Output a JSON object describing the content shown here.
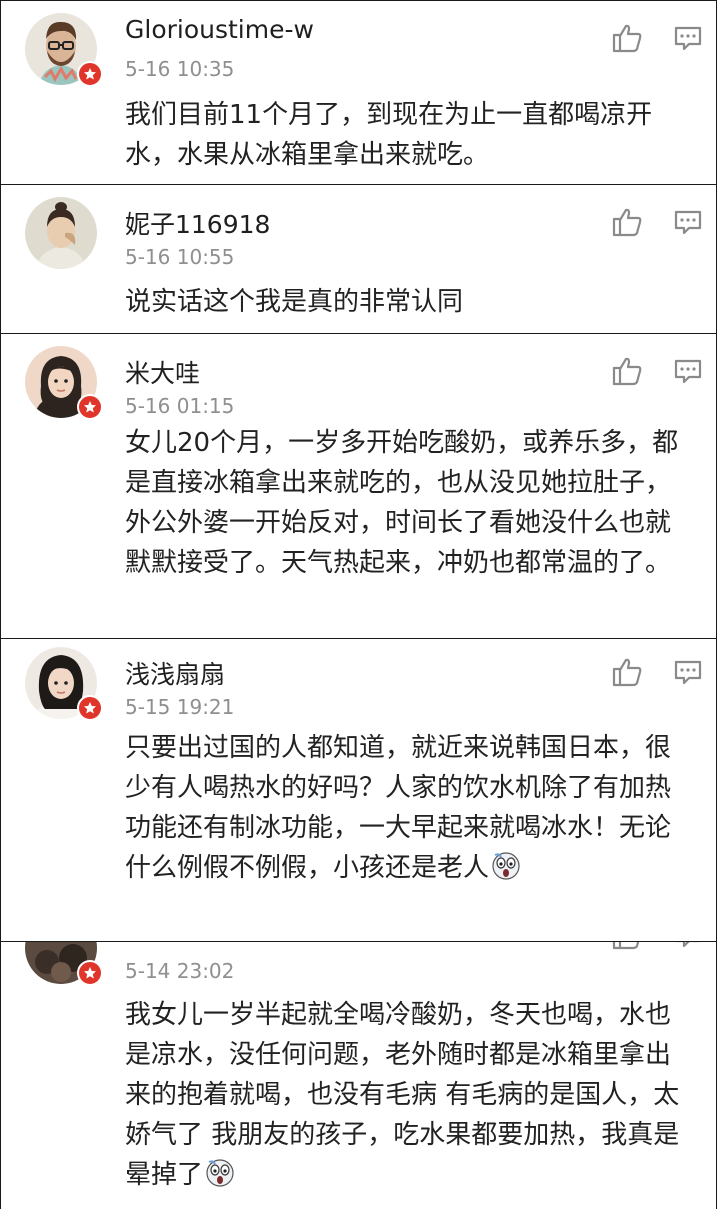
{
  "comments": [
    {
      "username": "Glorioustime-w",
      "time": "5-16 10:35",
      "text": "我们目前11个月了，到现在为止一直都喝凉开水，水果从冰箱里拿出来就吃。",
      "verified": true
    },
    {
      "username": "妮子116918",
      "time": "5-16 10:55",
      "text": "说实话这个我是真的非常认同",
      "verified": false
    },
    {
      "username": "米大哇",
      "time": "5-16 01:15",
      "text": "女儿20个月，一岁多开始吃酸奶，或养乐多，都是直接冰箱拿出来就吃的，也从没见她拉肚子，外公外婆一开始反对，时间长了看她没什么也就默默接受了。天气热起来，冲奶也都常温的了。",
      "verified": true
    },
    {
      "username": "浅浅扇扇",
      "time": "5-15 19:21",
      "text": "只要出过国的人都知道，就近来说韩国日本，很少有人喝热水的好吗？人家的饮水机除了有加热功能还有制冰功能，一大早起来就喝冰水！无论什么例假不例假，小孩还是老人",
      "verified": true,
      "emoji": "scared-face"
    },
    {
      "time": "5-14 23:02",
      "text": "我女儿一岁半起就全喝冷酸奶，冬天也喝，水也是凉水，没任何问题，老外随时都是冰箱里拿出来的抱着就喝，也没有毛病 有毛病的是国人，太娇气了 我朋友的孩子，吃水果都要加热，我真是晕掉了",
      "verified": true,
      "emoji": "scared-face"
    }
  ],
  "icons": {
    "like": "thumbs-up-icon",
    "reply": "comment-bubble-icon",
    "badge": "star-badge-icon"
  },
  "colors": {
    "badge": "#e0352b",
    "meta": "#8f8f8f",
    "icon": "#8a8a8a"
  }
}
